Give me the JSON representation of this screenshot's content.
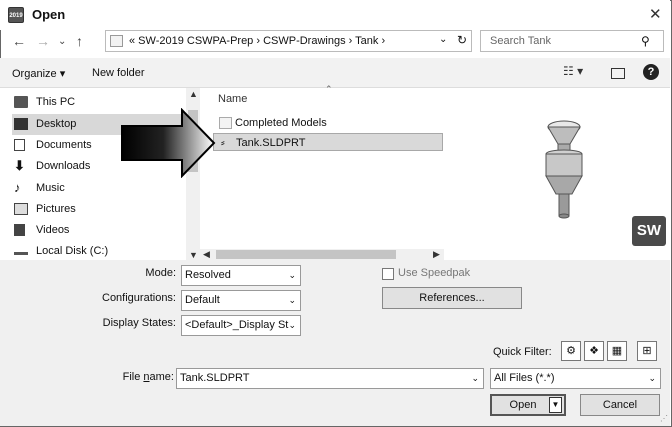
{
  "window": {
    "title": "Open",
    "app_badge": "2019"
  },
  "nav": {
    "back": "←",
    "forward": "→",
    "recent": "⌄",
    "up": "↑"
  },
  "address": {
    "path": "«  SW-2019 CSWPA-Prep  ›  CSWP-Drawings  ›  Tank  ›"
  },
  "search": {
    "placeholder": "Search Tank"
  },
  "toolbar": {
    "organize": "Organize ▾",
    "new_folder": "New folder"
  },
  "sidebar": {
    "items": [
      {
        "label": "This PC",
        "icon": "computer-icon"
      },
      {
        "label": "Desktop",
        "icon": "desktop-icon",
        "selected": true
      },
      {
        "label": "Documents",
        "icon": "documents-icon"
      },
      {
        "label": "Downloads",
        "icon": "downloads-icon"
      },
      {
        "label": "Music",
        "icon": "music-icon"
      },
      {
        "label": "Pictures",
        "icon": "pictures-icon"
      },
      {
        "label": "Videos",
        "icon": "videos-icon"
      },
      {
        "label": "Local Disk (C:)",
        "icon": "local-disk-icon"
      }
    ]
  },
  "files": {
    "column_name": "Name",
    "rows": [
      {
        "name": "Completed Models",
        "type": "folder"
      },
      {
        "name": "Tank.SLDPRT",
        "type": "part",
        "selected": true
      }
    ]
  },
  "preview": {
    "badge": "SW"
  },
  "options": {
    "mode_label": "Mode:",
    "mode_value": "Resolved",
    "configurations_label": "Configurations:",
    "configurations_value": "Default",
    "display_states_label": "Display States:",
    "display_states_value": "<Default>_Display St",
    "speedpak_label": "Use Speedpak",
    "references_button": "References...",
    "quick_filter_label": "Quick Filter:"
  },
  "filename": {
    "label_prefix": "File ",
    "label_underlined": "n",
    "label_suffix": "ame:",
    "value": "Tank.SLDPRT",
    "filter_value": "All Files (*.*)"
  },
  "buttons": {
    "open": "Open",
    "cancel": "Cancel"
  }
}
